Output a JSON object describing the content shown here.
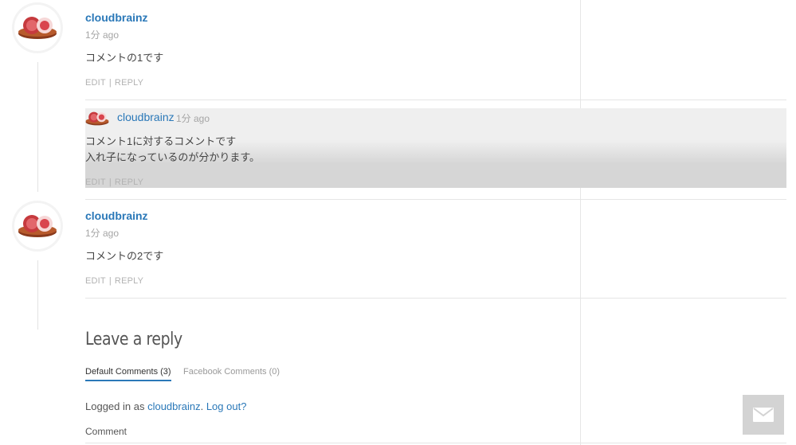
{
  "comments": [
    {
      "author": "cloudbrainz",
      "time": "1分 ago",
      "text": "コメントの1です",
      "actions": {
        "edit": "EDIT",
        "separator": "|",
        "reply": "REPLY"
      }
    },
    {
      "author": "cloudbrainz",
      "time": "1分 ago",
      "text_lines": [
        "コメント1に対するコメントです",
        "入れ子になっているのが分かります。"
      ],
      "actions": {
        "edit": "EDIT",
        "separator": "|",
        "reply": "REPLY"
      }
    },
    {
      "author": "cloudbrainz",
      "time": "1分 ago",
      "text": "コメントの2です",
      "actions": {
        "edit": "EDIT",
        "separator": "|",
        "reply": "REPLY"
      }
    }
  ],
  "reply_form": {
    "title": "Leave a reply",
    "tabs": [
      {
        "label": "Default Comments (3)",
        "active": true
      },
      {
        "label": "Facebook Comments (0)",
        "active": false
      }
    ],
    "logged_in_prefix": "Logged in as",
    "logged_in_user": "cloudbrainz",
    "logout_label": "Log out?",
    "comment_label": "Comment"
  },
  "colors": {
    "link": "#2a78b8",
    "muted": "#a5a5a5",
    "contact_button": "#d3d3d3"
  },
  "icons": {
    "avatar": "strawberry-daifuku-avatar",
    "contact": "envelope-icon"
  }
}
